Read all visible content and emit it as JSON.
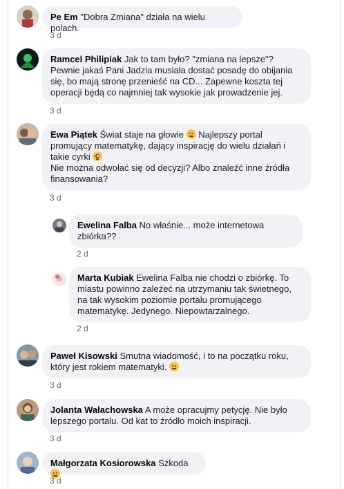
{
  "comments": [
    {
      "author": "Pe Em",
      "text": "\"Dobra Zmiana\" działa na wielu polach.",
      "time": "3 d"
    },
    {
      "author": "Ramcel Philipiak",
      "lines": [
        "Jak to tam było? \"zmiana na lepsze\"?",
        "Pewnie jakaś Pani Jadzia musiała dostać posadę do obijania",
        "się, bo mają stronę przenieść na CD... Zapewne koszta tej",
        "operacji będą co najmniej tak wysokie jak prowadzenie jej."
      ],
      "time": "3 d"
    },
    {
      "author": "Ewa Piątek",
      "lines": [
        "Świat staje na głowie",
        "Najlepszy portal",
        "promujący matematykę, dający inspirację do wielu działań i",
        "takie cyrki",
        "Nie można odwołać się od decyzji? Albo znaleźć inne źródła",
        "finansowania?"
      ],
      "emoji1": "confused-emoji",
      "emoji2": "flushed-emoji",
      "time": "3 d"
    },
    {
      "author": "Ewelina Falba",
      "lines": [
        "No właśnie... może internetowa",
        "zbiórka??"
      ],
      "time": "2 d"
    },
    {
      "author": "Marta Kubiak",
      "lines": [
        "Ewelina Falba nie chodzi o zbiórkę. To",
        "miastu powinno zależeć na utrzymaniu tak świetnego,",
        "na tak wysokim poziomie portalu promującego",
        "matematykę. Jedynego. Niepowtarzalnego."
      ],
      "time": "2 d"
    },
    {
      "author": "Paweł Kisowski",
      "lines": [
        "Smutna wiadomość, i to na początku roku,",
        "który jest rokiem matematyki."
      ],
      "emoji": "sad-emoji",
      "time": "3 d"
    },
    {
      "author": "Jolanta Wałachowska",
      "lines": [
        "A może opracujmy petycję. Nie było",
        "lepszego portalu. Od kat to źródło moich inspiracji."
      ],
      "time": "3 d"
    },
    {
      "author": "Małgorzata Kosiorowska",
      "text": "Szkoda",
      "emoji": "disappointed-emoji",
      "time": "3 d"
    }
  ]
}
